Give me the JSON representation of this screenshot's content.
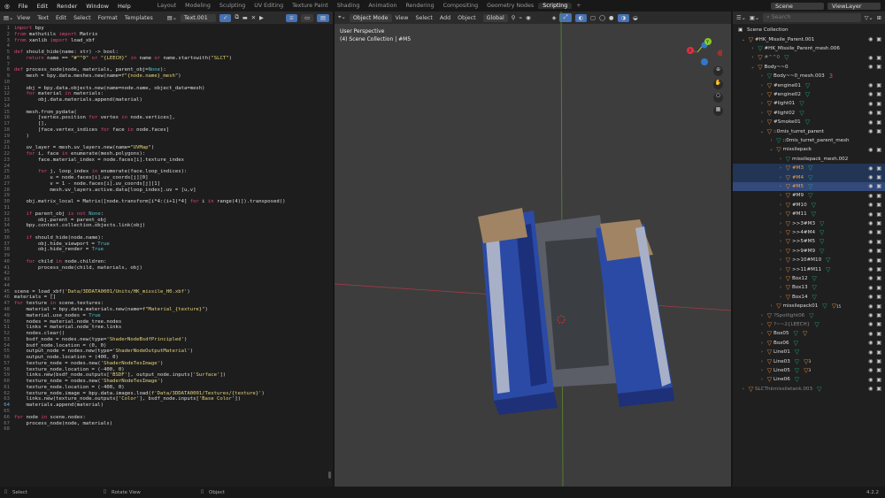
{
  "menu": {
    "items": [
      "File",
      "Edit",
      "Render",
      "Window",
      "Help"
    ]
  },
  "workspaces": {
    "tabs": [
      "Layout",
      "Modeling",
      "Sculpting",
      "UV Editing",
      "Texture Paint",
      "Shading",
      "Animation",
      "Rendering",
      "Compositing",
      "Geometry Nodes",
      "Scripting"
    ],
    "active": "Scripting",
    "add": "+"
  },
  "scene": {
    "label": "Scene",
    "view_layer": "ViewLayer"
  },
  "text_editor": {
    "menus": [
      "View",
      "Text",
      "Edit",
      "Select",
      "Format",
      "Templates"
    ],
    "file_name": "Text.001",
    "lines": [
      "import bpy",
      "from mathutils import Matrix",
      "from xanlib import load_xbf",
      "",
      "def should_hide(name: str) -> bool:",
      "    return name == \"#^^0\" or \"{LEECH}\" in name or name.startswith(\"SLCT\")",
      "",
      "def process_node(node, materials, parent_obj=None):",
      "    mesh = bpy.data.meshes.new(name=f\"{node.name}_mesh\")",
      "",
      "    obj = bpy.data.objects.new(name=node.name, object_data=mesh)",
      "    for material in materials:",
      "        obj.data.materials.append(material)",
      "",
      "    mesh.from_pydata(",
      "        [vertex.position for vertex in node.vertices],",
      "        [],",
      "        [face.vertex_indices for face in node.faces]",
      "    )",
      "",
      "    uv_layer = mesh.uv_layers.new(name=\"UVMap\")",
      "    for i, face in enumerate(mesh.polygons):",
      "        face.material_index = node.faces[i].texture_index",
      "",
      "        for j, loop_index in enumerate(face.loop_indices):",
      "            u = node.faces[i].uv_coords[j][0]",
      "            v = 1 - node.faces[i].uv_coords[j][1]",
      "            mesh.uv_layers.active.data[loop_index].uv = [u,v]",
      "",
      "    obj.matrix_local = Matrix([node.transform[i*4:(i+1)*4] for i in range(4)]).transposed()",
      "",
      "    if parent_obj is not None:",
      "        obj.parent = parent_obj",
      "    bpy.context.collection.objects.link(obj)",
      "",
      "    if should_hide(node.name):",
      "        obj.hide_viewport = True",
      "        obj.hide_render = True",
      "",
      "    for child in node.children:",
      "        process_node(child, materials, obj)",
      "",
      "",
      "",
      "scene = load_xbf('Data/3DDATA0001/Units/HK_missile_H0.xbf')",
      "materials = []",
      "for texture in scene.textures:",
      "    material = bpy.data.materials.new(name=f\"Material_{texture}\")",
      "    material.use_nodes = True",
      "    nodes = material.node_tree.nodes",
      "    links = material.node_tree.links",
      "    nodes.clear()",
      "    bsdf_node = nodes.new(type='ShaderNodeBsdfPrincipled')",
      "    bsdf_node.location = (0, 0)",
      "    output_node = nodes.new(type='ShaderNodeOutputMaterial')",
      "    output_node.location = (400, 0)",
      "    texture_node = nodes.new('ShaderNodeTexImage')",
      "    texture_node.location = (-400, 0)",
      "    links.new(bsdf_node.outputs['BSDF'], output_node.inputs['Surface'])",
      "    texture_node = nodes.new('ShaderNodeTexImage')",
      "    texture_node.location = (-400, 0)",
      "    texture_node.image = bpy.data.images.load(f'Data/3DDATA0001/Textures/{texture}')",
      "    links.new(texture_node.outputs['Color'], bsdf_node.inputs['Base Color'])",
      "    materials.append(material)",
      "",
      "for node in scene.nodes:",
      "    process_node(node, materials)",
      ""
    ]
  },
  "viewport": {
    "mode": "Object Mode",
    "menus": [
      "View",
      "Select",
      "Add",
      "Object"
    ],
    "orientation": "Global",
    "perspective": "User Perspective",
    "context": "(4) Scene Collection | #M5",
    "gizmo": {
      "x": "X",
      "y": "Y"
    }
  },
  "outliner": {
    "search_placeholder": "Search",
    "root": "Scene Collection",
    "rows": [
      {
        "name": "#HK_Missile_Parent.001",
        "level": 0,
        "open": true,
        "mesh": false,
        "eye": true
      },
      {
        "name": "#HK_Missile_Parent_mesh.006",
        "level": 1,
        "type": "mesh",
        "eye": false
      },
      {
        "name": "#^^0",
        "level": 1,
        "dim": true,
        "mesh": true,
        "eye": true
      },
      {
        "name": "Body~~0",
        "level": 1,
        "open": true,
        "eye": true
      },
      {
        "name": "Body~~0_mesh.003",
        "level": 2,
        "type": "mesh",
        "mat": "3",
        "eye": false
      },
      {
        "name": "#engine01",
        "level": 2,
        "mesh": true,
        "eye": true
      },
      {
        "name": "#engine02",
        "level": 2,
        "mesh": true,
        "eye": true
      },
      {
        "name": "#light01",
        "level": 2,
        "mesh": true,
        "eye": true
      },
      {
        "name": "#light02",
        "level": 2,
        "mesh": true,
        "eye": true
      },
      {
        "name": "#Smoke01",
        "level": 2,
        "mesh": true,
        "eye": true
      },
      {
        "name": "::0mis_turret_parent",
        "level": 2,
        "open": true,
        "eye": true
      },
      {
        "name": "::0mis_turret_parent_mesh",
        "level": 3,
        "type": "mesh",
        "eye": false
      },
      {
        "name": "missilepack",
        "level": 3,
        "open": true,
        "eye": true
      },
      {
        "name": "missilepack_mesh.002",
        "level": 4,
        "type": "mesh",
        "eye": false
      },
      {
        "name": "#M3",
        "level": 4,
        "mesh": true,
        "eye": true,
        "sel": true
      },
      {
        "name": "#M4",
        "level": 4,
        "mesh": true,
        "eye": true,
        "sel": true
      },
      {
        "name": "#M5",
        "level": 4,
        "mesh": true,
        "eye": true,
        "act": true
      },
      {
        "name": "#M9",
        "level": 4,
        "mesh": true,
        "eye": true
      },
      {
        "name": "#M10",
        "level": 4,
        "mesh": true,
        "eye": true
      },
      {
        "name": "#M11",
        "level": 4,
        "mesh": true,
        "eye": true
      },
      {
        "name": ">>3#M3",
        "level": 4,
        "mesh": true,
        "eye": true
      },
      {
        "name": ">>4#M4",
        "level": 4,
        "mesh": true,
        "eye": true
      },
      {
        "name": ">>5#M5",
        "level": 4,
        "mesh": true,
        "eye": true
      },
      {
        "name": ">>9#M9",
        "level": 4,
        "mesh": true,
        "eye": true
      },
      {
        "name": ">>10#M10",
        "level": 4,
        "mesh": true,
        "eye": true
      },
      {
        "name": ">>11#M11",
        "level": 4,
        "mesh": true,
        "eye": true
      },
      {
        "name": "Box12",
        "level": 4,
        "mesh": true,
        "eye": true
      },
      {
        "name": "Box13",
        "level": 4,
        "mesh": true,
        "eye": true
      },
      {
        "name": "Box14",
        "level": 4,
        "mesh": true,
        "eye": true
      },
      {
        "name": "missilepack01",
        "level": 3,
        "mesh": true,
        "child": "15",
        "eye": true
      },
      {
        "name": "?Spotlight06",
        "level": 2,
        "dim": true,
        "mesh": true,
        "eye": true
      },
      {
        "name": "?~~2{LEECH}",
        "level": 2,
        "dim": true,
        "mesh": true,
        "eye": true
      },
      {
        "name": "Box05",
        "level": 2,
        "mesh": true,
        "child": "",
        "eye": true
      },
      {
        "name": "Box06",
        "level": 2,
        "mesh": true,
        "eye": true
      },
      {
        "name": "Line01",
        "level": 2,
        "mesh": true,
        "eye": true
      },
      {
        "name": "Line03",
        "level": 2,
        "mesh": true,
        "child": "3",
        "eye": true
      },
      {
        "name": "Line05",
        "level": 2,
        "mesh": true,
        "child": "3",
        "eye": true
      },
      {
        "name": "Line06",
        "level": 2,
        "mesh": true,
        "eye": true
      },
      {
        "name": "SLCThkmissiletank.003",
        "level": 0,
        "dim": true,
        "mesh": true,
        "eye": true
      }
    ]
  },
  "status": {
    "select": "Select",
    "rotate": "Rotate View",
    "object": "Object",
    "version": "4.2.2"
  },
  "colors": {
    "accent": "#4772b3",
    "object": "#e08a3c",
    "mesh": "#1fa37a",
    "keyword": "#e0457b",
    "string": "#e5d37b",
    "number": "#4fc1c9"
  }
}
